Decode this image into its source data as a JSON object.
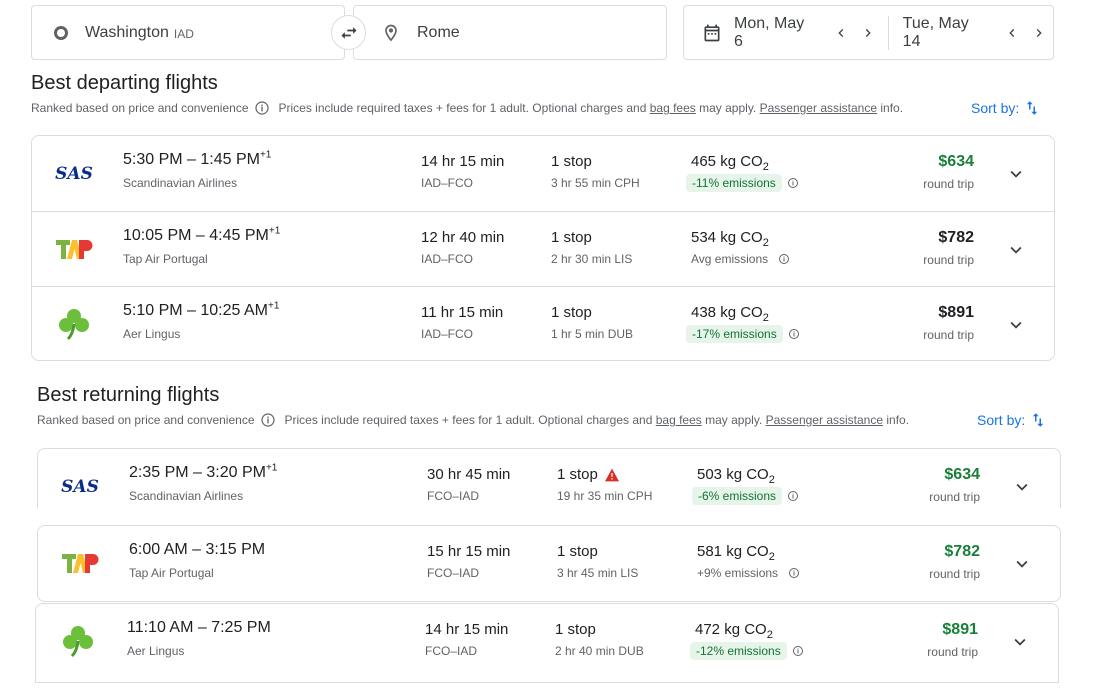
{
  "search": {
    "origin": "Washington",
    "origin_code": "IAD",
    "destination": "Rome",
    "depart_date": "Mon, May 6",
    "return_date": "Tue, May 14"
  },
  "departing": {
    "title": "Best departing flights",
    "ranked": "Ranked based on price and convenience",
    "prices_note": "Prices include required taxes + fees for 1 adult. Optional charges and",
    "bag_fees": "bag fees",
    "may_apply": "may apply.",
    "passenger_assistance": "Passenger assistance",
    "info": "info.",
    "sort_by": "Sort by:",
    "flights": [
      {
        "times": "5:30 PM – 1:45 PM",
        "plus": "+1",
        "airline": "Scandinavian Airlines",
        "duration": "14 hr 15 min",
        "route": "IAD–FCO",
        "stops": "1 stop",
        "layover": "3 hr 55 min CPH",
        "co2": "465 kg CO",
        "co2_sub": "2",
        "emissions": "-11% emissions",
        "price": "$634",
        "price_type": "round trip"
      },
      {
        "times": "10:05 PM – 4:45 PM",
        "plus": "+1",
        "airline": "Tap Air Portugal",
        "duration": "12 hr 40 min",
        "route": "IAD–FCO",
        "stops": "1 stop",
        "layover": "2 hr 30 min LIS",
        "co2": "534 kg CO",
        "co2_sub": "2",
        "emissions": "Avg emissions",
        "price": "$782",
        "price_type": "round trip"
      },
      {
        "times": "5:10 PM – 10:25 AM",
        "plus": "+1",
        "airline": "Aer Lingus",
        "duration": "11 hr 15 min",
        "route": "IAD–FCO",
        "stops": "1 stop",
        "layover": "1 hr 5 min DUB",
        "co2": "438 kg CO",
        "co2_sub": "2",
        "emissions": "-17% emissions",
        "price": "$891",
        "price_type": "round trip"
      }
    ]
  },
  "returning": {
    "title": "Best returning flights",
    "ranked": "Ranked based on price and convenience",
    "prices_note": "Prices include required taxes + fees for 1 adult. Optional charges and",
    "bag_fees": "bag fees",
    "may_apply": "may apply.",
    "passenger_assistance": "Passenger assistance",
    "info": "info.",
    "sort_by": "Sort by:",
    "flights": [
      {
        "times": "2:35 PM – 3:20 PM",
        "plus": "+1",
        "airline": "Scandinavian Airlines",
        "duration": "30 hr 45 min",
        "route": "FCO–IAD",
        "stops": "1 stop",
        "layover": "19 hr 35 min CPH",
        "co2": "503 kg CO",
        "co2_sub": "2",
        "emissions": "-6% emissions",
        "price": "$634",
        "price_type": "round trip"
      },
      {
        "times": "6:00 AM – 3:15 PM",
        "plus": "",
        "airline": "Tap Air Portugal",
        "duration": "15 hr 15 min",
        "route": "FCO–IAD",
        "stops": "1 stop",
        "layover": "3 hr 45 min LIS",
        "co2": "581 kg CO",
        "co2_sub": "2",
        "emissions": "+9% emissions",
        "price": "$782",
        "price_type": "round trip"
      },
      {
        "times": "11:10 AM – 7:25 PM",
        "plus": "",
        "airline": "Aer Lingus",
        "duration": "14 hr 15 min",
        "route": "FCO–IAD",
        "stops": "1 stop",
        "layover": "2 hr 40 min DUB",
        "co2": "472 kg CO",
        "co2_sub": "2",
        "emissions": "-12% emissions",
        "price": "$891",
        "price_type": "round trip"
      }
    ]
  },
  "colors": {
    "accent": "#1a73e8",
    "price_green": "#188038",
    "emission_bg": "#e6f4ea",
    "emission_text": "#137333",
    "warning": "#d93025"
  }
}
